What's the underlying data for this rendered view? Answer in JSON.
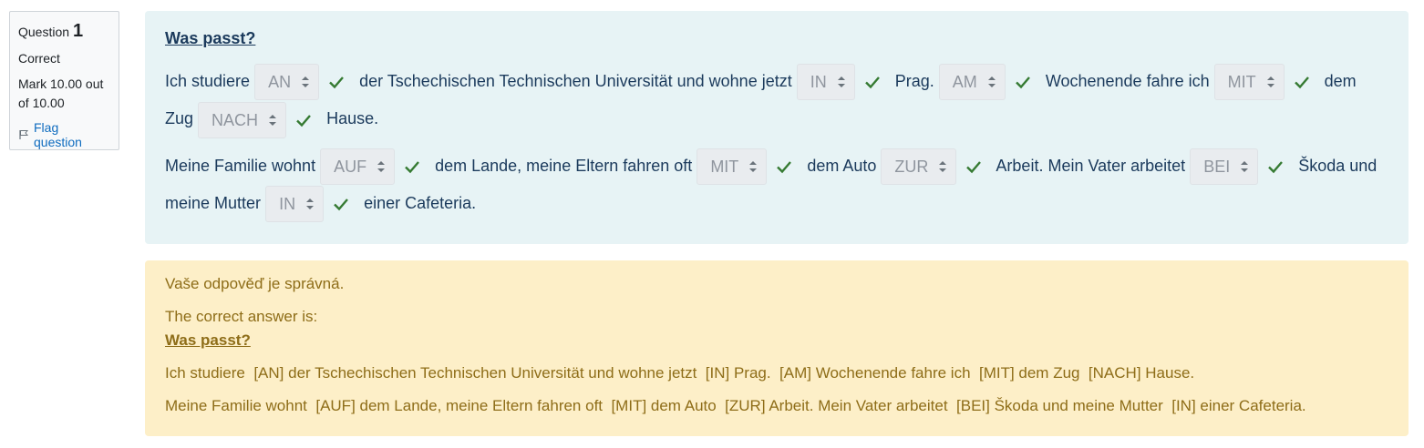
{
  "info": {
    "question_label": "Question",
    "question_number": "1",
    "state": "Correct",
    "mark_line1": "Mark 10.00 out",
    "mark_line2": "of 10.00",
    "flag_label": "Flag question"
  },
  "question": {
    "title": "Was passt?",
    "p1": {
      "t1": "Ich studiere",
      "s1": "AN",
      "t2": "der Tschechischen Technischen Universität und wohne jetzt",
      "s2": "IN",
      "t3": "Prag.",
      "s3": "AM",
      "t4": "Wochenende fahre ich",
      "s4": "MIT",
      "t5": "dem Zug",
      "s5": "NACH",
      "t6": "Hause."
    },
    "p2": {
      "t1": "Meine Familie wohnt",
      "s1": "AUF",
      "t2": "dem Lande, meine Eltern fahren oft",
      "s2": "MIT",
      "t3": "dem Auto",
      "s3": "ZUR",
      "t4": "Arbeit. Mein Vater arbeitet",
      "s4": "BEI",
      "t5": "Škoda und meine Mutter",
      "s5": "IN",
      "t6": "einer Cafeteria."
    }
  },
  "feedback": {
    "result": "Vaše odpověď je správná.",
    "correct_intro": "The correct answer is:",
    "title": "Was passt?",
    "line1": "Ich studiere  [AN] der Tschechischen Technischen Universität und wohne jetzt  [IN] Prag.  [AM] Wochenende fahre ich  [MIT] dem Zug  [NACH] Hause.",
    "line2": "Meine Familie wohnt  [AUF] dem Lande, meine Eltern fahren oft  [MIT] dem Auto  [ZUR] Arbeit. Mein Vater arbeitet  [BEI] Škoda und meine Mutter  [IN] einer Cafeteria."
  },
  "colors": {
    "content_bg": "#e7f3f5",
    "feedback_bg": "#fdefc8",
    "tick": "#357a32",
    "link": "#0f6cbf"
  }
}
